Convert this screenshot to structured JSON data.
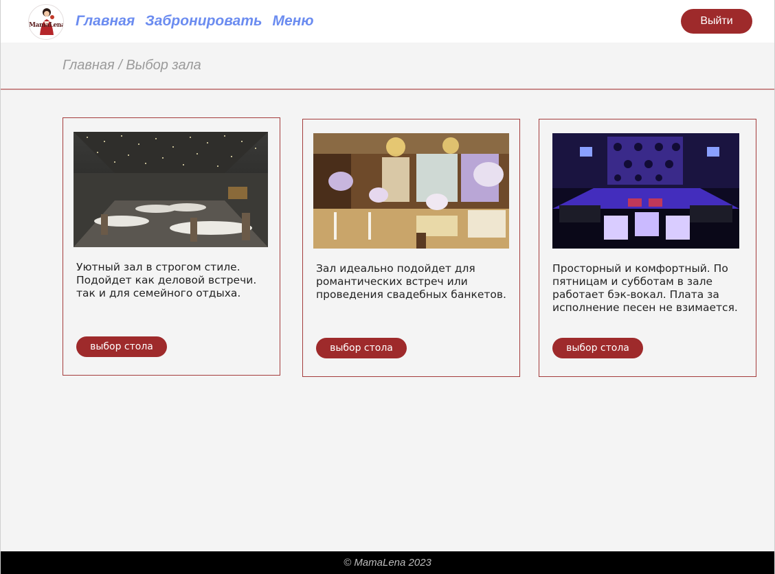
{
  "header": {
    "logo_text": "MamaLena",
    "nav": [
      "Главная",
      "Забронировать",
      "Меню"
    ],
    "logout_label": "Выйти"
  },
  "breadcrumb": "Главная / Выбор зала",
  "halls": [
    {
      "photo": "restaurant-hall-photo",
      "lines": [
        "Уютный зал в строгом стиле.",
        "Подойдет как деловой встречи.",
        "так и для семейного отдыха."
      ],
      "button": "выбор стола"
    },
    {
      "photo": "banquet-hall-photo",
      "lines": [
        "Зал идеально подойдет для",
        "романтических встреч или",
        "проведения свадебных банкетов."
      ],
      "button": "выбор стола"
    },
    {
      "photo": "karaoke-lounge-photo",
      "lines": [
        "Просторный и комфортный. По",
        "пятницам и субботам в зале",
        "работает бэк-вокал. Плата за",
        "исполнение песен не взимается."
      ],
      "button": "выбор стола"
    }
  ],
  "footer": "© MamaLena 2023",
  "colors": {
    "accent": "#9e2a2b",
    "nav": "#6b8cf0",
    "border": "#a33a3a"
  }
}
